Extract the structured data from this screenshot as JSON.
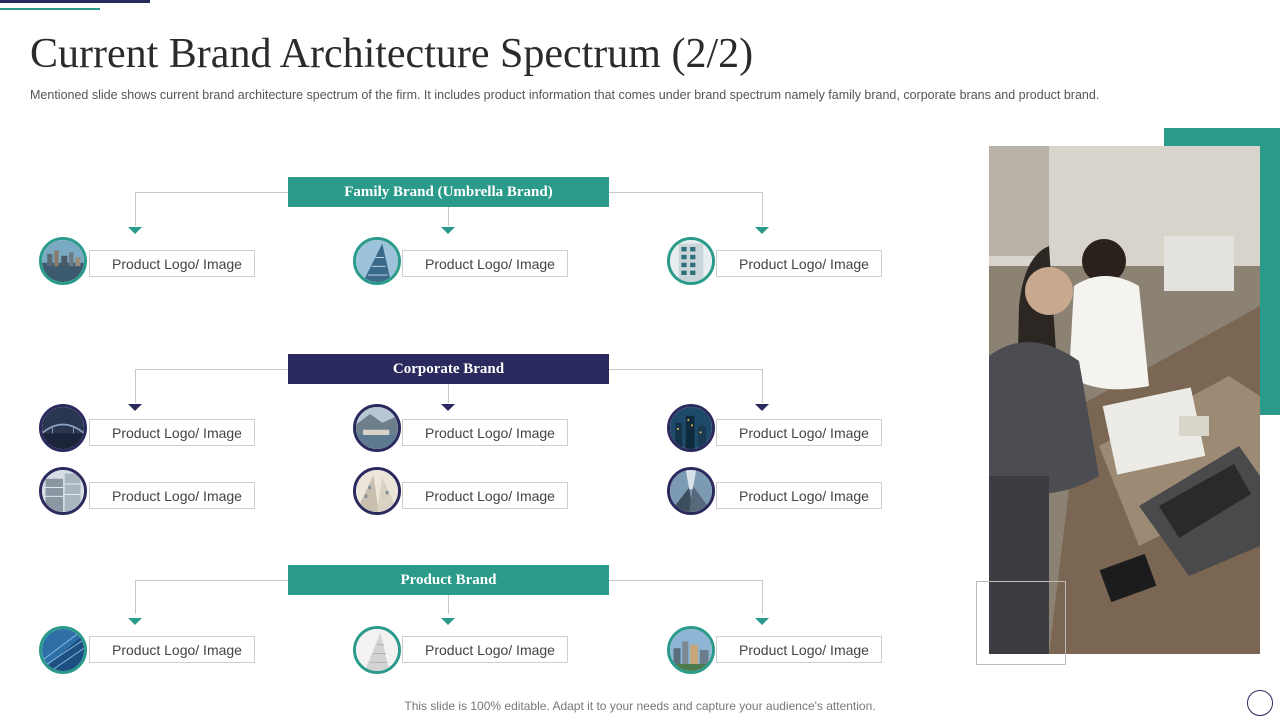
{
  "title": "Current Brand Architecture Spectrum (2/2)",
  "subtitle": "Mentioned slide shows current brand architecture spectrum of the firm. It includes product information that comes under brand spectrum namely family brand, corporate brans and product brand.",
  "groups": [
    {
      "label": "Family Brand (Umbrella Brand)",
      "color": "#2a9a8a",
      "items": [
        {
          "label": "Product Logo/ Image",
          "icon": "city-skyline-image"
        },
        {
          "label": "Product Logo/ Image",
          "icon": "glass-tower-image"
        },
        {
          "label": "Product Logo/ Image",
          "icon": "apartment-building-image"
        }
      ]
    },
    {
      "label": "Corporate Brand",
      "color": "#2b2a5e",
      "items": [
        {
          "label": "Product Logo/ Image",
          "icon": "bridge-image"
        },
        {
          "label": "Product Logo/ Image",
          "icon": "coastal-city-image"
        },
        {
          "label": "Product Logo/ Image",
          "icon": "night-towers-image"
        },
        {
          "label": "Product Logo/ Image",
          "icon": "office-building-image"
        },
        {
          "label": "Product Logo/ Image",
          "icon": "street-buildings-image"
        },
        {
          "label": "Product Logo/ Image",
          "icon": "skyscraper-lookup-image"
        }
      ]
    },
    {
      "label": "Product Brand",
      "color": "#2a9a8a",
      "items": [
        {
          "label": "Product Logo/ Image",
          "icon": "glass-facade-image"
        },
        {
          "label": "Product Logo/ Image",
          "icon": "white-tower-image"
        },
        {
          "label": "Product Logo/ Image",
          "icon": "downtown-skyline-image"
        }
      ]
    }
  ],
  "footer": "This slide is 100% editable. Adapt it to your needs and capture your audience's attention.",
  "colors": {
    "teal": "#2a9a8a",
    "navy": "#2b2a5e"
  }
}
